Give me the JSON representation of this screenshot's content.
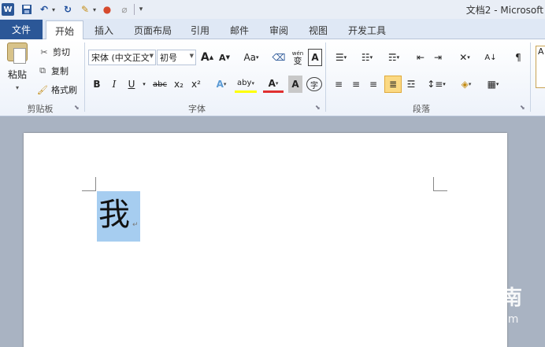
{
  "titlebar": {
    "app_icon": "W",
    "title": "文档2 - Microsoft",
    "quick_access": {
      "save": "save-icon",
      "undo": "undo-icon",
      "redo": "redo-icon"
    }
  },
  "tabs": {
    "file": "文件",
    "items": [
      "开始",
      "插入",
      "页面布局",
      "引用",
      "邮件",
      "审阅",
      "视图",
      "开发工具"
    ],
    "active": "开始"
  },
  "ribbon": {
    "clipboard": {
      "paste": "粘贴",
      "cut": "剪切",
      "copy": "复制",
      "format_painter": "格式刷",
      "label": "剪贴板"
    },
    "font": {
      "name": "宋体 (中文正文",
      "size": "初号",
      "grow": "A",
      "shrink": "A",
      "case": "Aa",
      "bold": "B",
      "italic": "I",
      "underline": "U",
      "strike": "abc",
      "subscript": "x₂",
      "superscript": "x²",
      "text_effect": "A",
      "highlight": "aby",
      "font_color": "A",
      "shading": "A",
      "enclose": "字",
      "phonetic": "wén",
      "border": "A",
      "label": "字体"
    },
    "paragraph": {
      "label": "段落"
    },
    "styles_edge": "A"
  },
  "document": {
    "text": "我",
    "para_mark": "↵"
  },
  "watermark": {
    "name": "搜狗指南",
    "url": "zhinan.sogou.com",
    "logo": "S"
  }
}
